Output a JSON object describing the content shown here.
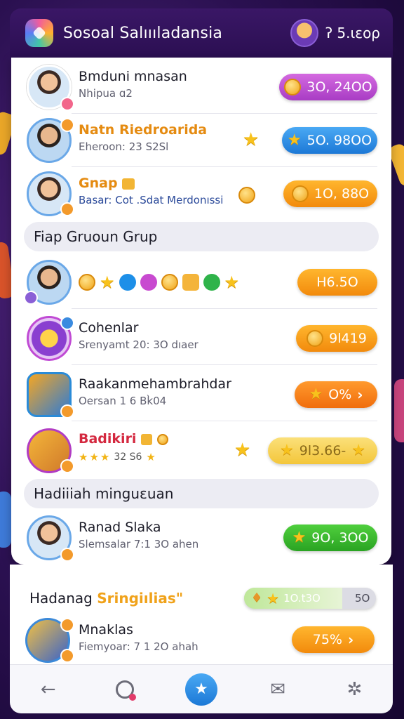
{
  "header": {
    "title": "Sosoal Salıııladansia",
    "balance": "ʔ 5.ιεορ"
  },
  "rows_top": [
    {
      "name": "Bmduni mnasan",
      "sub": "Nhipua ɑ2",
      "value": "3O, 24OO",
      "pill_color": "purple"
    },
    {
      "name": "Natn Riedroarida",
      "sub": "Eheroon: 23 S2Sl",
      "value": "5O. 98OO",
      "pill_color": "blue"
    },
    {
      "name": "Gnap",
      "sub": "Basar: Cot .Sdat Merdonıssi",
      "value": "1O, 88O",
      "pill_color": "orange"
    }
  ],
  "section_group": {
    "title": "Fiap Gruoun Grup"
  },
  "rows_group": [
    {
      "value": "H6.5O",
      "pill_color": "orange"
    },
    {
      "name": "Cohenlar",
      "sub": "Srenyamt 20: 3O dıaer",
      "value": "9l419",
      "pill_color": "orange"
    },
    {
      "name": "Raakanmehambrahdar",
      "sub": "Oersan 1 6 Bk̀04",
      "value": "O%",
      "pill_color": "orange2"
    },
    {
      "name": "Badikiri",
      "mini_value": "32 S6",
      "value": "9l3.66-",
      "pill_color": "yellow"
    }
  ],
  "section_weekly": {
    "title": "Hadiiiah minguɛuan"
  },
  "rows_weekly": [
    {
      "name": "Ranad Slaka",
      "sub": "Slemsalar 7:1 3O ahen",
      "value": "9O, 3OO",
      "pill_color": "green"
    }
  ],
  "below": {
    "title_prefix": "Hadanag ",
    "title_highlight": "Sringiılias\"",
    "progress_value": "1O.t3O",
    "progress_extra": "5O",
    "row": {
      "name": "Mnaklas",
      "sub": "Fiemyoar: 7 1 2O ahah",
      "value": "75%"
    }
  },
  "colors": {
    "purple": "#b64acc",
    "blue": "#2a8be0",
    "orange": "#f59a1c",
    "green": "#34b02a",
    "header": "#2e1157"
  },
  "nav": [
    "back-arrow-icon",
    "record-icon",
    "star-icon",
    "mail-icon",
    "puzzle-icon"
  ]
}
